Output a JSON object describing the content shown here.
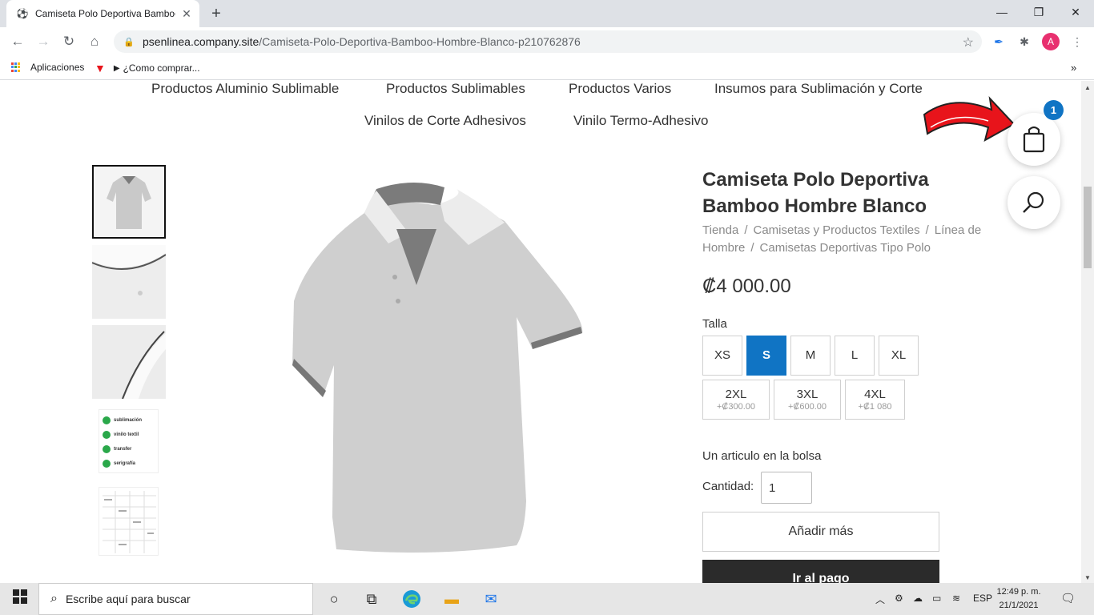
{
  "browser": {
    "tab_title": "Camiseta Polo Deportiva Bamboo",
    "url_host": "psenlinea.company.site",
    "url_path": "/Camiseta-Polo-Deportiva-Bamboo-Hombre-Blanco-p210762876",
    "profile_initial": "A",
    "bookmarks": {
      "apps": "Aplicaciones",
      "como_comprar": "¿Como comprar..."
    }
  },
  "nav": {
    "row1": [
      "Productos Aluminio Sublimable",
      "Productos Sublimables",
      "Productos Varios",
      "Insumos para Sublimación y Corte"
    ],
    "row2": [
      "Vinilos de Corte Adhesivos",
      "Vinilo Termo-Adhesivo"
    ]
  },
  "product": {
    "title": "Camiseta Polo Deportiva Bamboo Hombre Blanco",
    "breadcrumbs": [
      "Tienda",
      "Camisetas y Productos Textiles",
      "Línea de Hombre",
      "Camisetas Deportivas Tipo Polo"
    ],
    "price": "₡4 000.00",
    "size_label": "Talla",
    "sizes_row1": [
      {
        "name": "XS",
        "selected": false
      },
      {
        "name": "S",
        "selected": true
      },
      {
        "name": "M",
        "selected": false
      },
      {
        "name": "L",
        "selected": false
      },
      {
        "name": "XL",
        "selected": false
      }
    ],
    "sizes_row2": [
      {
        "name": "2XL",
        "extra": "+₡300.00"
      },
      {
        "name": "3XL",
        "extra": "+₡600.00"
      },
      {
        "name": "4XL",
        "extra": "+₡1 080"
      }
    ],
    "bag_message": "Un articulo en la bolsa",
    "quantity_label": "Cantidad:",
    "quantity_value": "1",
    "add_more": "Añadir más",
    "checkout": "Ir al pago"
  },
  "thumbnails": {
    "print_methods": [
      "sublimación",
      "vinilo textil",
      "transfer",
      "serigrafía"
    ]
  },
  "cart": {
    "count": "1"
  },
  "taskbar": {
    "search_placeholder": "Escribe aquí para buscar",
    "language": "ESP",
    "time": "12:49 p. m.",
    "date": "21/1/2021"
  },
  "colors": {
    "accent": "#1074c4",
    "checkout_bg": "#2b2b2b",
    "arrow": "#e8141b"
  }
}
